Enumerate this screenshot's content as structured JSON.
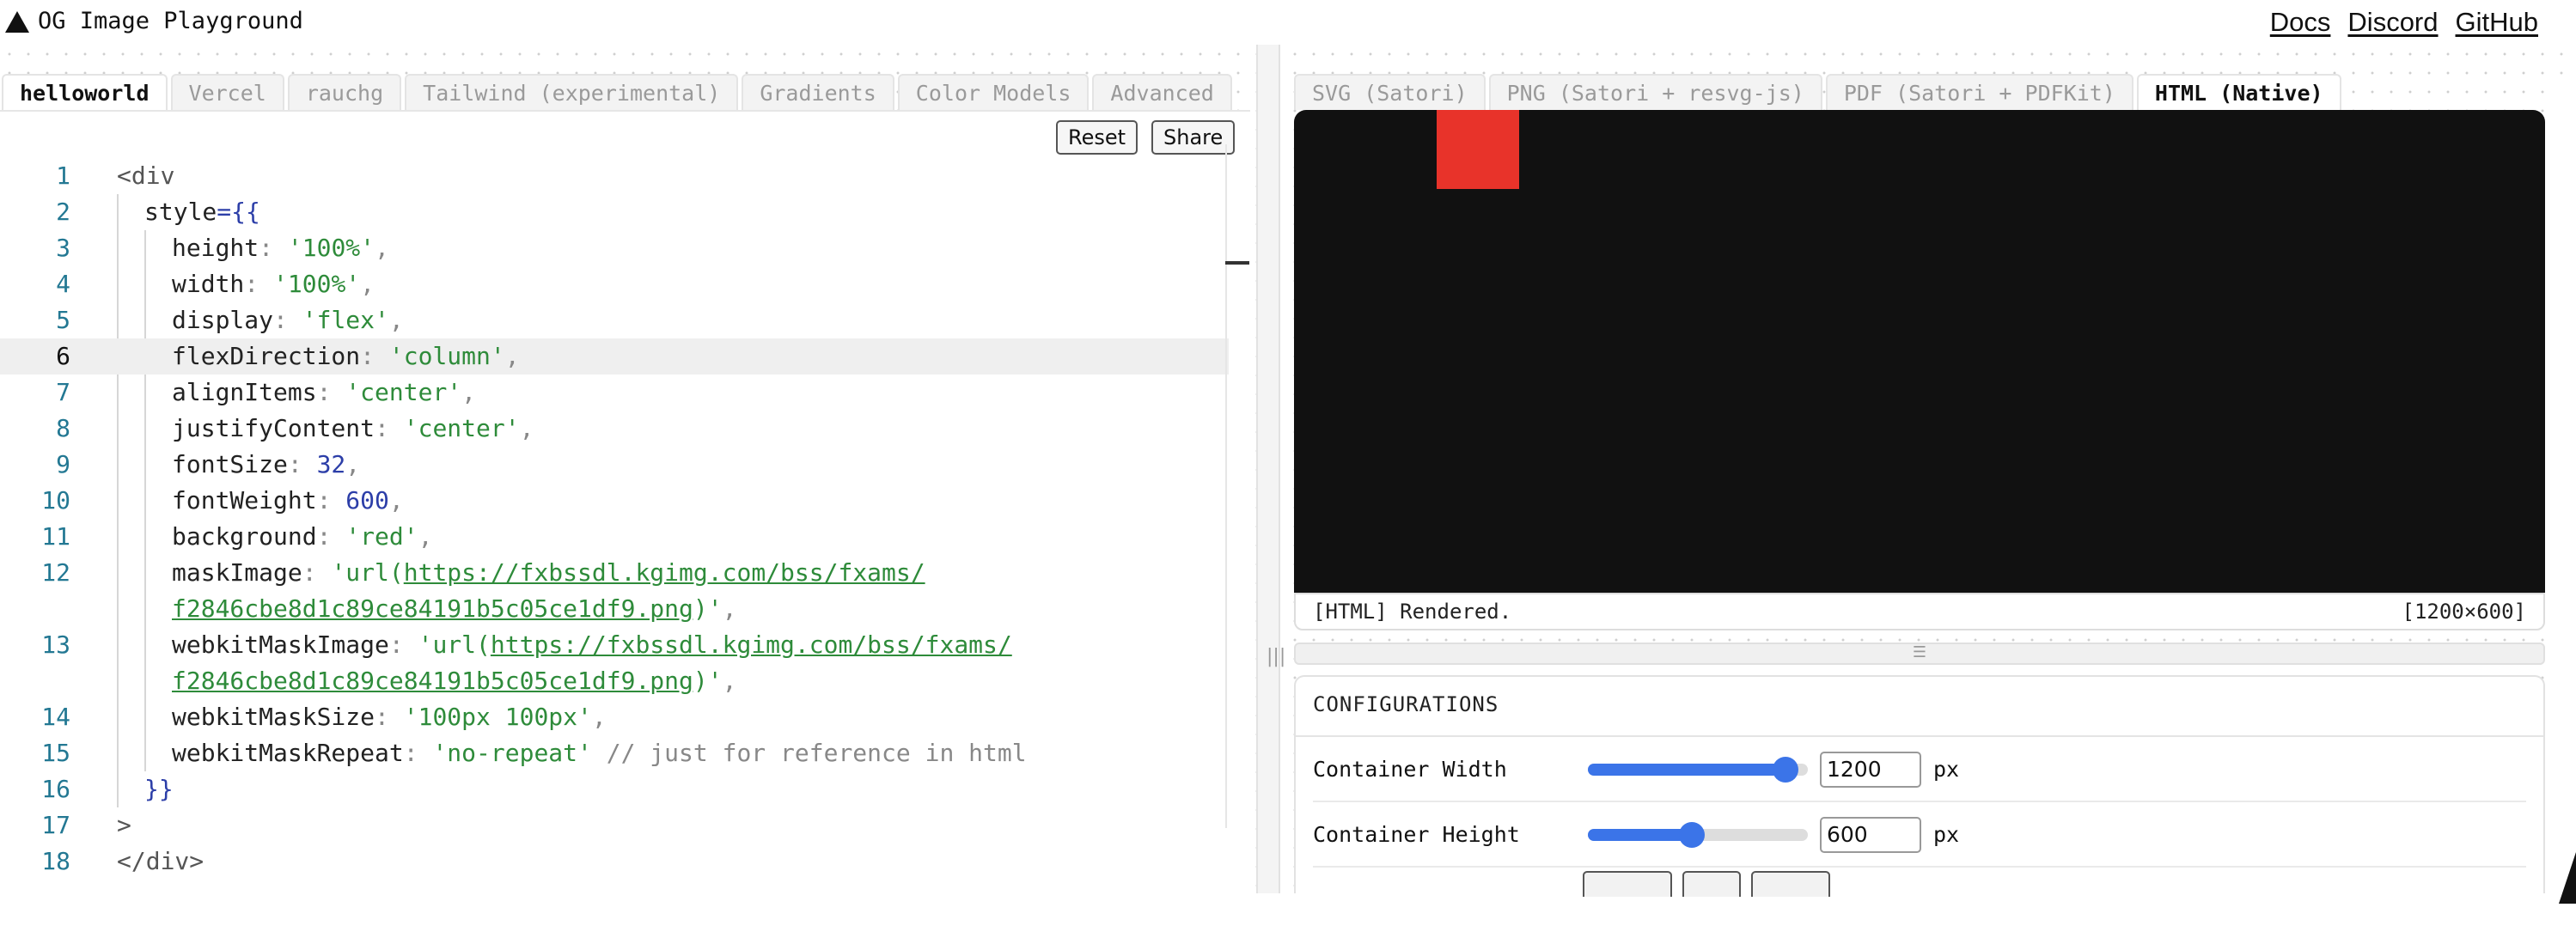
{
  "header": {
    "title": "OG Image Playground",
    "links": [
      "Docs",
      "Discord",
      "GitHub"
    ]
  },
  "editor_tabs": [
    "helloworld",
    "Vercel",
    "rauchg",
    "Tailwind (experimental)",
    "Gradients",
    "Color Models",
    "Advanced"
  ],
  "editor_buttons": {
    "reset": "Reset",
    "share": "Share"
  },
  "code": {
    "l1": "<div",
    "l2_key": "style",
    "l2_rest": "={{",
    "l3_key": "height",
    "l3_val": "'100%'",
    "l4_key": "width",
    "l4_val": "'100%'",
    "l5_key": "display",
    "l5_val": "'flex'",
    "l6_key": "flexDirection",
    "l6_val": "'column'",
    "l7_key": "alignItems",
    "l7_val": "'center'",
    "l8_key": "justifyContent",
    "l8_val": "'center'",
    "l9_key": "fontSize",
    "l9_val": "32",
    "l10_key": "fontWeight",
    "l10_val": "600",
    "l11_key": "background",
    "l11_val": "'red'",
    "l12_key": "maskImage",
    "l12_pre": "'url(",
    "l12_url1": "https://fxbssdl.kgimg.com/bss/fxams/",
    "l12_url2": "f2846cbe8d1c89ce84191b5c05ce1df9.png",
    "l12_post": ")'",
    "l13_key": "webkitMaskImage",
    "l13_pre": "'url(",
    "l13_url1": "https://fxbssdl.kgimg.com/bss/fxams/",
    "l13_url2": "f2846cbe8d1c89ce84191b5c05ce1df9.png",
    "l13_post": ")'",
    "l14_key": "webkitMaskSize",
    "l14_val": "'100px 100px'",
    "l15_key": "webkitMaskRepeat",
    "l15_val": "'no-repeat'",
    "l15_cmt": "// just for reference in html",
    "l16": "}}",
    "l17": ">",
    "l18": "</div>"
  },
  "line_numbers": [
    "1",
    "2",
    "3",
    "4",
    "5",
    "6",
    "7",
    "8",
    "9",
    "10",
    "11",
    "12",
    "13",
    "14",
    "15",
    "16",
    "17",
    "18"
  ],
  "preview_tabs": [
    "SVG (Satori)",
    "PNG (Satori + resvg-js)",
    "PDF (Satori + PDFKit)",
    "HTML (Native)"
  ],
  "status": {
    "message": "[HTML] Rendered.",
    "size": "[1200×600]"
  },
  "config": {
    "heading": "CONFIGURATIONS",
    "width_label": "Container Width",
    "width_value": "1200",
    "width_fraction": 0.95,
    "height_label": "Container Height",
    "height_value": "600",
    "height_fraction": 0.47,
    "unit": "px"
  },
  "colors": {
    "accent": "#3b74e8",
    "preview_bg": "#111111",
    "red_box": "#e8332a"
  }
}
